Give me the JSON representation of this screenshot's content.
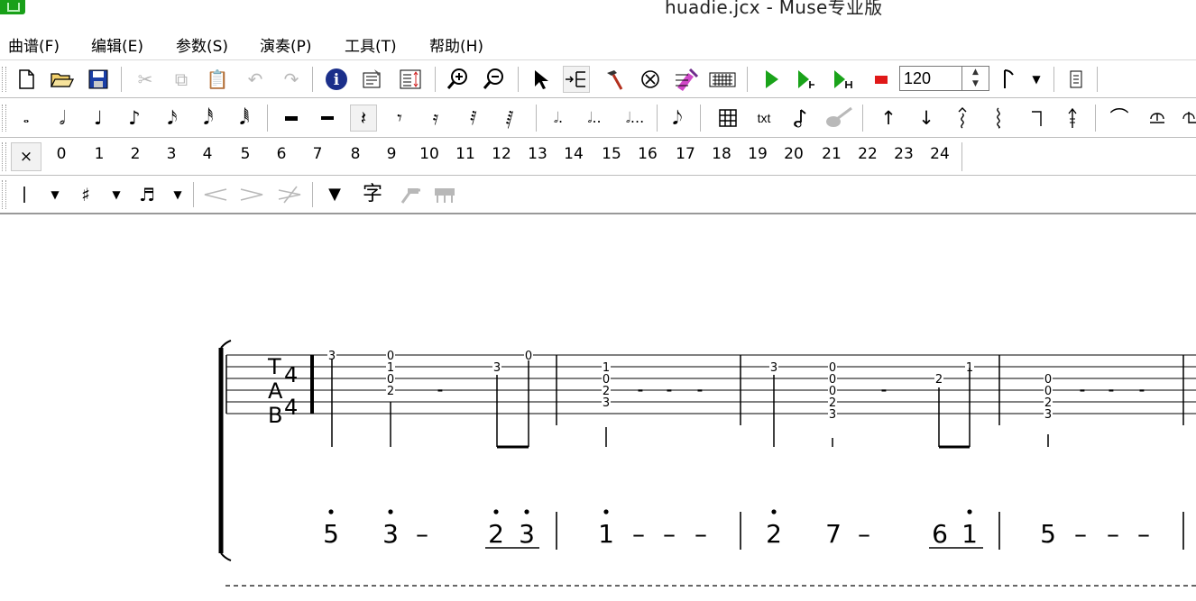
{
  "window": {
    "title": "huadie.jcx - Muse专业版"
  },
  "menu": [
    "曲谱(F)",
    "编辑(E)",
    "参数(S)",
    "演奏(P)",
    "工具(T)",
    "帮助(H)"
  ],
  "transport": {
    "tempo": "120",
    "spin_up": "▲",
    "spin_down": "▼"
  },
  "fret_selector": {
    "clear": "×",
    "frets": [
      "0",
      "1",
      "2",
      "3",
      "4",
      "5",
      "6",
      "7",
      "8",
      "9",
      "10",
      "11",
      "12",
      "13",
      "14",
      "15",
      "16",
      "17",
      "18",
      "19",
      "20",
      "21",
      "22",
      "23",
      "24"
    ]
  },
  "toolbar_text": {
    "txt_label": "txt",
    "lyric_label": "字"
  },
  "score": {
    "clef": [
      "T",
      "A",
      "B"
    ],
    "time_signature": {
      "top": "4",
      "bottom": "4"
    },
    "tab_notes": [
      {
        "measure": 1,
        "string": 1,
        "fret": "3"
      },
      {
        "measure": 1,
        "string": 1,
        "fret": "0"
      },
      {
        "measure": 1,
        "string": 2,
        "fret": "1"
      },
      {
        "measure": 1,
        "string": 3,
        "fret": "0"
      },
      {
        "measure": 1,
        "string": 4,
        "fret": "2"
      },
      {
        "measure": 1,
        "string": 2,
        "fret": "3"
      },
      {
        "measure": 1,
        "string": 1,
        "fret": "0"
      },
      {
        "measure": 2,
        "string": 2,
        "fret": "1"
      },
      {
        "measure": 2,
        "string": 3,
        "fret": "0"
      },
      {
        "measure": 2,
        "string": 4,
        "fret": "2"
      },
      {
        "measure": 2,
        "string": 5,
        "fret": "3"
      },
      {
        "measure": 3,
        "string": 2,
        "fret": "3"
      },
      {
        "measure": 3,
        "string": 2,
        "fret": "0"
      },
      {
        "measure": 3,
        "string": 3,
        "fret": "0"
      },
      {
        "measure": 3,
        "string": 4,
        "fret": "0"
      },
      {
        "measure": 3,
        "string": 5,
        "fret": "2"
      },
      {
        "measure": 3,
        "string": 6,
        "fret": "3"
      },
      {
        "measure": 3,
        "string": 3,
        "fret": "2"
      },
      {
        "measure": 3,
        "string": 2,
        "fret": "1"
      },
      {
        "measure": 4,
        "string": 3,
        "fret": "0"
      },
      {
        "measure": 4,
        "string": 4,
        "fret": "0"
      },
      {
        "measure": 4,
        "string": 5,
        "fret": "2"
      },
      {
        "measure": 4,
        "string": 6,
        "fret": "3"
      }
    ],
    "rest_dash": "-",
    "jianpu": [
      {
        "num": "5",
        "dot": "above"
      },
      {
        "num": "3",
        "dot": "above"
      },
      {
        "num": "–"
      },
      {
        "num": "2",
        "dot": "above",
        "underline": true
      },
      {
        "num": "3",
        "dot": "above",
        "underline": true
      },
      {
        "num": "1",
        "dot": "above"
      },
      {
        "num": "–"
      },
      {
        "num": "–"
      },
      {
        "num": "–"
      },
      {
        "num": "2",
        "dot": "above"
      },
      {
        "num": "7"
      },
      {
        "num": "–"
      },
      {
        "num": "6",
        "underline": true
      },
      {
        "num": "1",
        "dot": "above",
        "underline": true
      },
      {
        "num": "5"
      },
      {
        "num": "–"
      },
      {
        "num": "–"
      },
      {
        "num": "–"
      }
    ]
  }
}
